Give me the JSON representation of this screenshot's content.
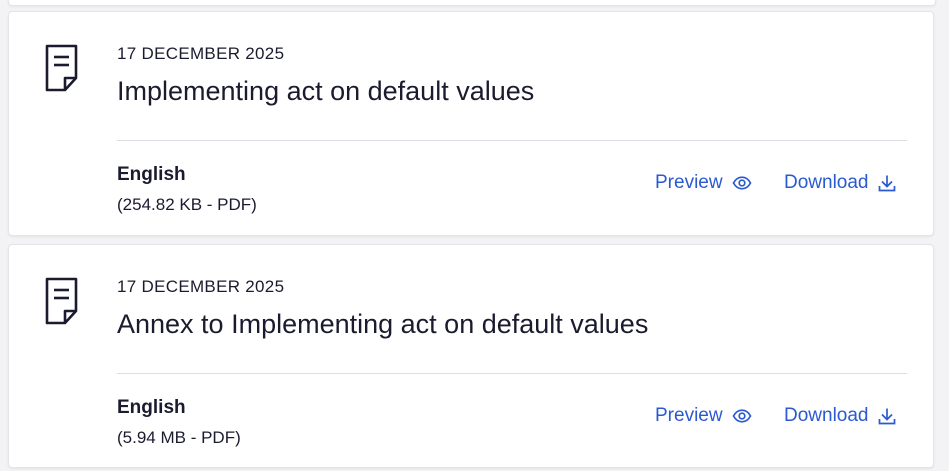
{
  "documents": [
    {
      "date": "17 DECEMBER 2025",
      "title": "Implementing act on default values",
      "language": "English",
      "file_info": "(254.82 KB - PDF)",
      "preview_label": "Preview",
      "download_label": "Download"
    },
    {
      "date": "17 DECEMBER 2025",
      "title": "Annex to Implementing act on default values",
      "language": "English",
      "file_info": "(5.94 MB - PDF)",
      "preview_label": "Preview",
      "download_label": "Download"
    }
  ],
  "icons": {
    "document": "document-icon",
    "preview": "eye-icon",
    "download": "download-icon"
  },
  "colors": {
    "link": "#2a59d0",
    "text": "#1b1b2f",
    "background": "#f3f3f5",
    "card": "#ffffff"
  }
}
